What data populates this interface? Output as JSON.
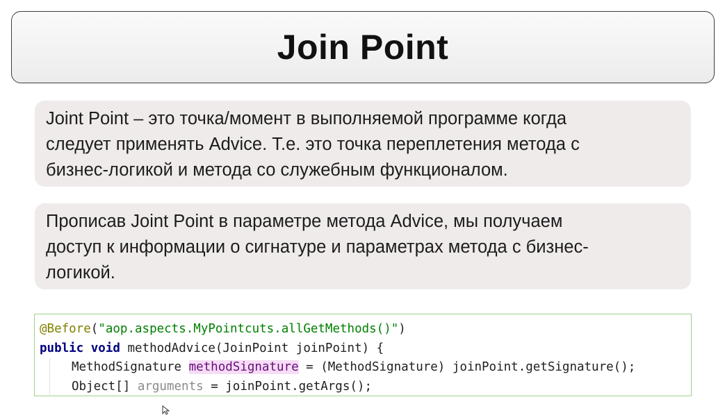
{
  "title": "Join Point",
  "box1": {
    "lines": [
      "Joint Point – это точка/момент в выполняемой программе когда",
      "следует применять Advice. Т.е. это точка переплетения метода с",
      "бизнес-логикой и метода со служебным функционалом."
    ]
  },
  "box2": {
    "lines": [
      "Прописав Joint Point в параметре метода Advice, мы получаем",
      "доступ к информации о сигнатуре и параметрах метода с бизнес-",
      "логикой."
    ]
  },
  "code": {
    "line1": {
      "annotation": "@Before",
      "open": "(",
      "string": "\"aop.aspects.MyPointcuts.allGetMethods()\"",
      "close": ")"
    },
    "line2": {
      "kw_public": "public",
      "kw_void": "void",
      "rest": " methodAdvice(JoinPoint joinPoint) {"
    },
    "line3": {
      "type": "MethodSignature ",
      "var": "methodSignature",
      "rest": " = (MethodSignature) joinPoint.getSignature();"
    },
    "line4": {
      "type": "Object[] ",
      "var": "arguments",
      "rest": " = joinPoint.getArgs();"
    }
  },
  "colors": {
    "annotation": "#808000",
    "string": "#008000",
    "keyword": "#000080",
    "highlight_bg": "#f6dcf6",
    "code_border": "#9fd08a",
    "box_bg": "#efebeb"
  }
}
